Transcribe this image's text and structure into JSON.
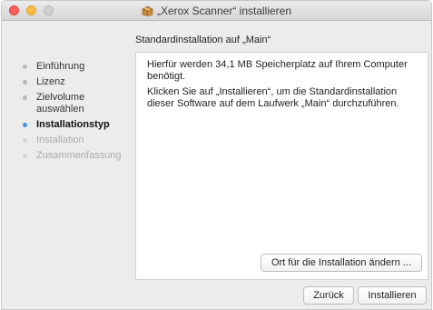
{
  "window": {
    "title": "„Xerox Scanner“ installieren",
    "accent": "#4a8fe8"
  },
  "header": {
    "text": "Standardinstallation auf „Main“"
  },
  "sidebar": {
    "items": [
      {
        "label": "Einführung",
        "state": "done"
      },
      {
        "label": "Lizenz",
        "state": "done"
      },
      {
        "label": "Zielvolume auswählen",
        "state": "done"
      },
      {
        "label": "Installationstyp",
        "state": "active"
      },
      {
        "label": "Installation",
        "state": "pending"
      },
      {
        "label": "Zusammenfassung",
        "state": "pending"
      }
    ]
  },
  "content": {
    "para1": "Hierfür werden 34,1 MB Speicherplatz auf Ihrem Computer benötigt.",
    "para2": "Klicken Sie auf „Installieren“, um die Standardinstallation dieser Software auf dem Laufwerk „Main“ durchzuführen.",
    "change_location_label": "Ort für die Installation ändern ..."
  },
  "footer": {
    "back_label": "Zurück",
    "install_label": "Installieren"
  },
  "icons": {
    "window": "package-icon"
  }
}
